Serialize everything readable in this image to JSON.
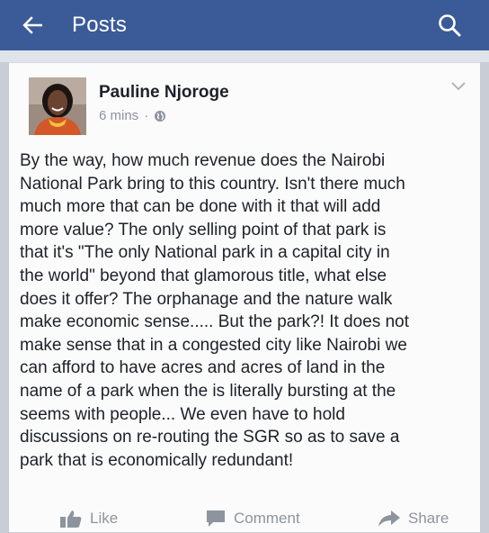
{
  "header": {
    "title": "Posts",
    "back_icon": "arrow-left-icon",
    "search_icon": "search-icon",
    "color": "#3b5a98"
  },
  "post": {
    "author": "Pauline Njoroge",
    "time": "6 mins",
    "separator": "·",
    "privacy_icon": "globe-icon",
    "lines": [
      "By the way, how much revenue does the Nairobi",
      "National Park bring to this country. Isn't there much",
      "much more that can be done with it that will add",
      "more value? The only selling point of that park is",
      "that it's \"The only National park in a capital city in",
      "the world\" beyond that glamorous title, what else",
      "does it offer? The orphanage and the nature walk",
      "make economic sense..... But the park?! It does not",
      "make sense that in a congested city like Nairobi we",
      "can afford to have acres and acres of land in the",
      "name of a park when the is literally bursting at the",
      "seems with people... We even have to hold",
      "discussions on re-routing the SGR so as to save a",
      "park that is economically redundant!"
    ]
  },
  "actions": {
    "like": "Like",
    "comment": "Comment",
    "share": "Share"
  }
}
